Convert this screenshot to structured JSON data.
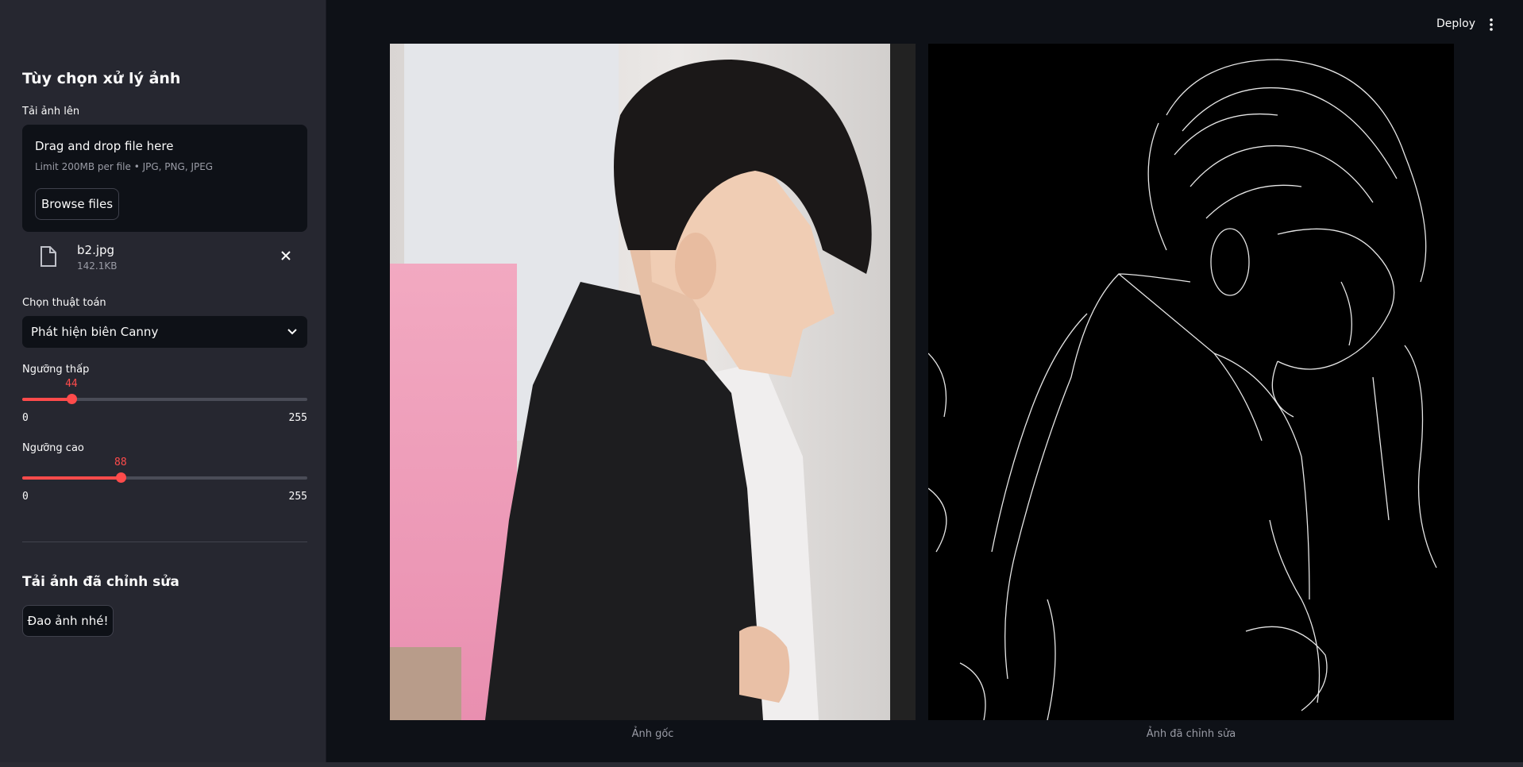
{
  "sidebar": {
    "title": "Tùy chọn xử lý ảnh",
    "upload_label": "Tải ảnh lên",
    "dropzone": {
      "title": "Drag and drop file here",
      "limit": "Limit 200MB per file • JPG, PNG, JPEG",
      "browse_label": "Browse files"
    },
    "file": {
      "name": "b2.jpg",
      "size": "142.1KB"
    },
    "algorithm_label": "Chọn thuật toán",
    "algorithm_value": "Phát hiện biên Canny",
    "low_threshold": {
      "label": "Ngưỡng thấp",
      "value": "44",
      "value_num": 44,
      "min": "0",
      "max": "255"
    },
    "high_threshold": {
      "label": "Ngưỡng cao",
      "value": "88",
      "value_num": 88,
      "min": "0",
      "max": "255"
    },
    "download_title": "Tải ảnh đã chỉnh sửa",
    "download_button": "Đao ảnh nhé!"
  },
  "header": {
    "deploy_label": "Deploy"
  },
  "main": {
    "original_caption": "Ảnh gốc",
    "edited_caption": "Ảnh đã chỉnh sửa"
  },
  "colors": {
    "accent": "#ff4b4b",
    "sidebar_bg": "#262730",
    "main_bg": "#0e1117"
  }
}
